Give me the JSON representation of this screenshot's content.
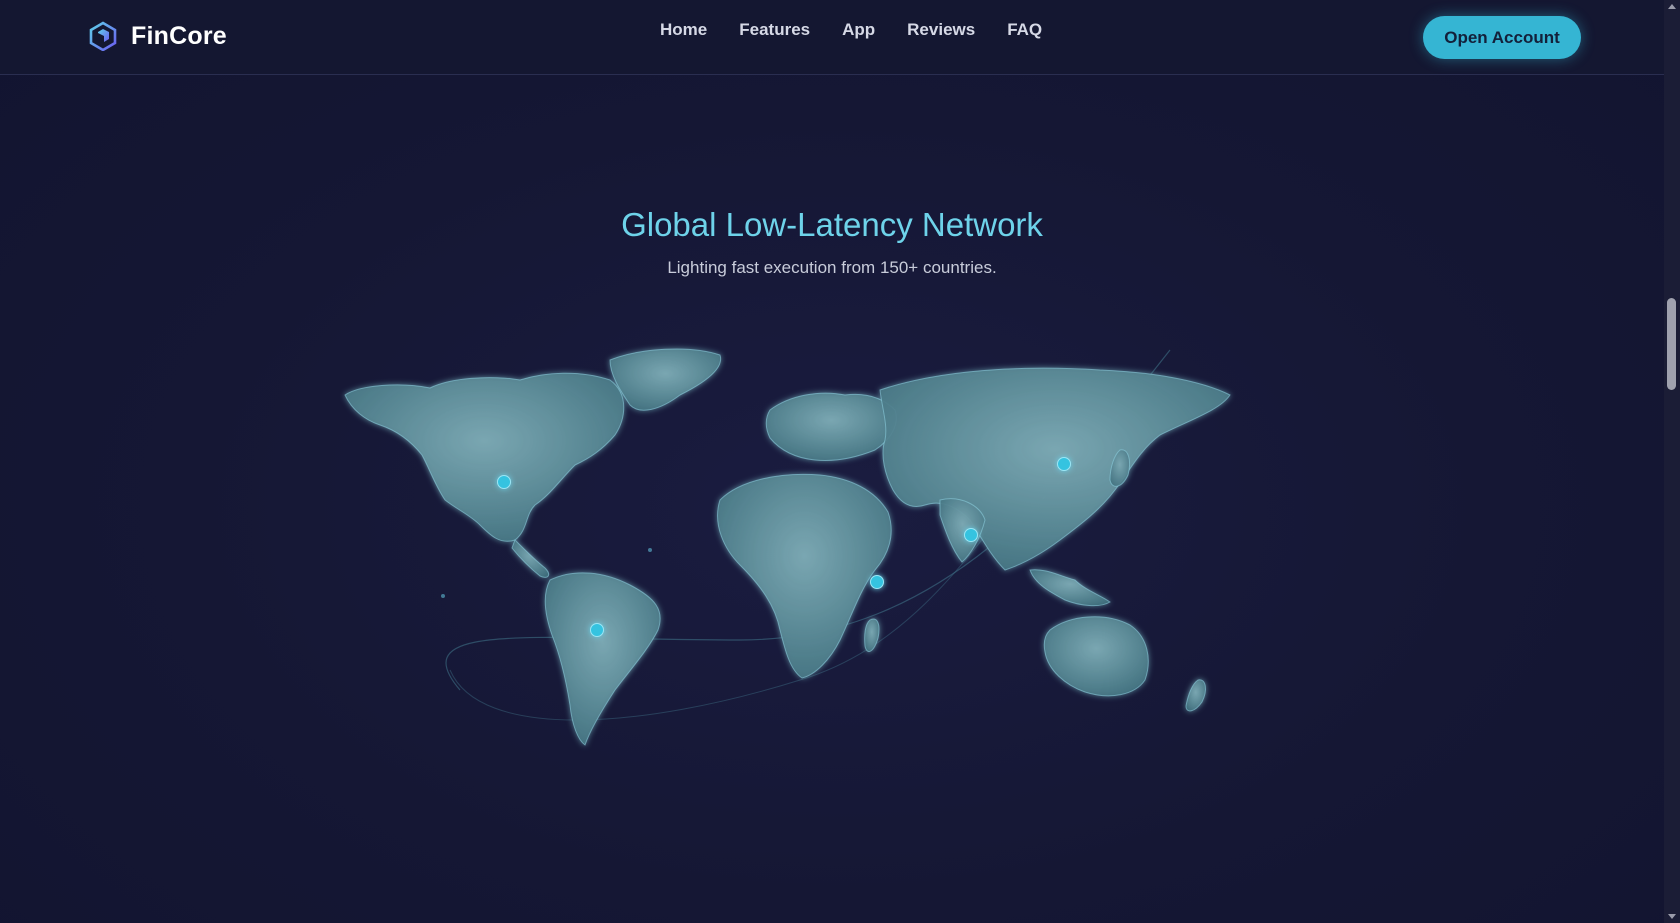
{
  "brand": {
    "name": "FinCore",
    "logo_icon": "hexagon-logo-icon"
  },
  "nav": {
    "items": [
      {
        "label": "Home"
      },
      {
        "label": "Features"
      },
      {
        "label": "App"
      },
      {
        "label": "Reviews"
      },
      {
        "label": "FAQ"
      }
    ],
    "cta_label": "Open Account"
  },
  "section": {
    "title": "Global Low-Latency Network",
    "subtitle": "Lighting fast execution from 150+ countries."
  },
  "colors": {
    "background": "#151733",
    "accent": "#35b5d3",
    "title": "#6ed3ea",
    "map_land": "#4e7f8c"
  }
}
